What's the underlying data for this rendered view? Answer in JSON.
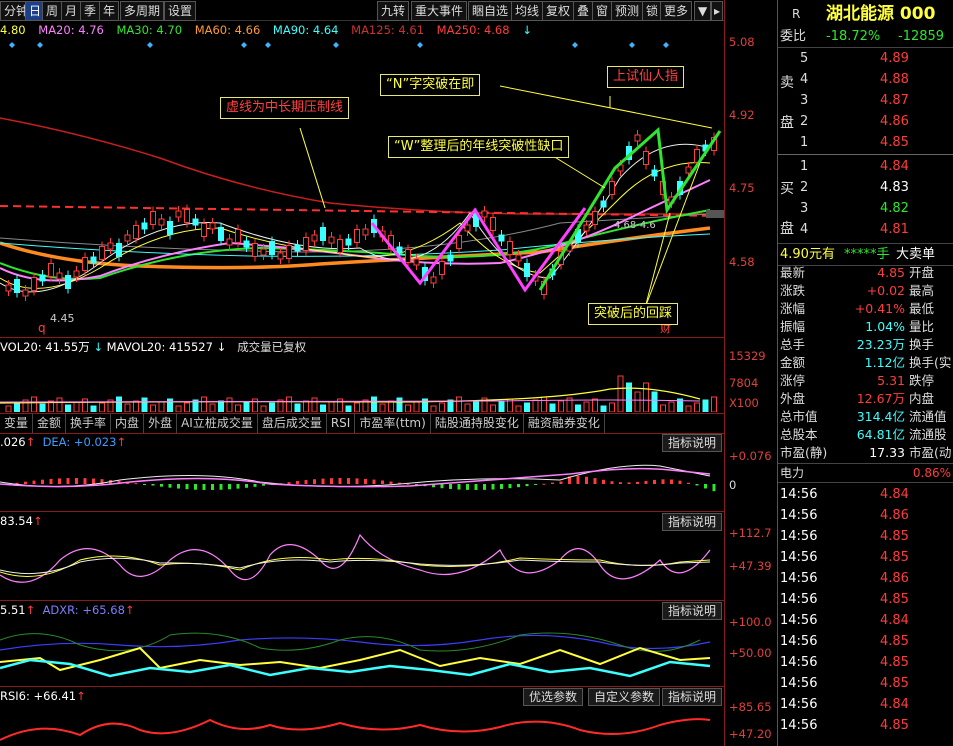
{
  "toolbar": {
    "items": [
      "分钟",
      "日",
      "周",
      "月",
      "季",
      "年",
      "多周期",
      "设置"
    ],
    "right_items": [
      "九转",
      "重大事件",
      "睏自选",
      "均线",
      "复权",
      "叠",
      "窗",
      "预测",
      "锁",
      "更多",
      "▼"
    ]
  },
  "ma_legend": [
    {
      "text": "4.80",
      "color": "#ffff3c"
    },
    {
      "text": "MA20: 4.76",
      "color": "#ff80ff"
    },
    {
      "text": "MA30: 4.70",
      "color": "#2ee62e"
    },
    {
      "text": "MA60: 4.66",
      "color": "#ff9a2e"
    },
    {
      "text": "MA90: 4.64",
      "color": "#3cffff"
    },
    {
      "text": "MA125: 4.61",
      "color": "#cc2222"
    },
    {
      "text": "MA250: 4.68",
      "color": "#ff3c3c"
    }
  ],
  "price_axis": [
    "5.08",
    "4.92",
    "4.75",
    "4.58"
  ],
  "annotations": {
    "resistance": "虚线为中长期压制线",
    "n_breakout": "“N”字突破在即",
    "immortal": "上试仙人指",
    "w_gap": "“W”整理后的年线突破性缺口",
    "pullback": "突破后的回踩"
  },
  "chart_labels": {
    "low": "4.45",
    "gap": "4.68-4.6",
    "q": "q",
    "cai": "财"
  },
  "volume": {
    "legend_a": "VOL20: 41.55万",
    "legend_b": "MAVOL20: 415527",
    "legend_c": "成交量已复权",
    "axis": [
      "15329",
      "7804",
      "X100"
    ]
  },
  "tabs": [
    "变量",
    "金额",
    "换手率",
    "内盘",
    "外盘",
    "AI立桩成交量",
    "盘后成交量",
    "RSI",
    "市盈率(ttm)",
    "陆股通持股变化",
    "融资融券变化"
  ],
  "macd": {
    "legend_a": ".026",
    "legend_b": "DEA: +0.023",
    "axis": [
      "+0.076",
      "0"
    ],
    "btn": "指标说明"
  },
  "kdj": {
    "legend_a": "83.54",
    "axis": [
      "+112.7",
      "+47.39"
    ],
    "btn": "指标说明"
  },
  "dmi": {
    "legend_a": "5.51",
    "legend_b": "ADXR: +65.68",
    "axis": [
      "+100.0",
      "+50.00"
    ],
    "btn": "指标说明"
  },
  "rsi": {
    "legend_a": "RSI6: +66.41",
    "axis": [
      "+85.65",
      "+47.20"
    ],
    "btn_a": "优选参数",
    "btn_b": "自定义参数",
    "btn_c": "指标说明"
  },
  "right_panel": {
    "r_mark": "R",
    "name": "湖北能源 000",
    "weibi_label": "委比",
    "weibi_pct": "-18.72%",
    "weibi_val": "-12859",
    "sell_label_top": "卖",
    "sell_label_bot": "盘",
    "buy_label_top": "买",
    "buy_label_bot": "盘",
    "sell": [
      {
        "n": "5",
        "p": "4.89"
      },
      {
        "n": "4",
        "p": "4.88"
      },
      {
        "n": "3",
        "p": "4.87"
      },
      {
        "n": "2",
        "p": "4.86"
      },
      {
        "n": "1",
        "p": "4.85"
      }
    ],
    "buy": [
      {
        "n": "1",
        "p": "4.84"
      },
      {
        "n": "2",
        "p": "4.83"
      },
      {
        "n": "3",
        "p": "4.82"
      },
      {
        "n": "4",
        "p": "4.81"
      }
    ],
    "big_price": "4.90元有",
    "big_stars": "*****手",
    "big_label": "大卖单",
    "stats": [
      {
        "l": "最新",
        "v": "4.85",
        "r": "开盘"
      },
      {
        "l": "涨跌",
        "v": "+0.02",
        "r": "最高"
      },
      {
        "l": "涨幅",
        "v": "+0.41%",
        "r": "最低"
      },
      {
        "l": "振幅",
        "v": "1.04%",
        "r": "量比"
      },
      {
        "l": "总手",
        "v": "23.23万",
        "r": "换手"
      },
      {
        "l": "金额",
        "v": "1.12亿",
        "r": "换手(实"
      },
      {
        "l": "涨停",
        "v": "5.31",
        "r": "跌停"
      },
      {
        "l": "外盘",
        "v": "12.67万",
        "r": "内盘"
      },
      {
        "l": "总市值",
        "v": "314.4亿",
        "r": "流通值"
      },
      {
        "l": "总股本",
        "v": "64.81亿",
        "r": "流通股"
      },
      {
        "l": "市盈(静)",
        "v": "17.33",
        "r": "市盈(动"
      }
    ],
    "sector": "电力",
    "sector_pct": "0.86%",
    "ticks": [
      {
        "t": "14:56",
        "p": "4.84"
      },
      {
        "t": "14:56",
        "p": "4.86"
      },
      {
        "t": "14:56",
        "p": "4.85"
      },
      {
        "t": "14:56",
        "p": "4.85"
      },
      {
        "t": "14:56",
        "p": "4.86"
      },
      {
        "t": "14:56",
        "p": "4.85"
      },
      {
        "t": "14:56",
        "p": "4.84"
      },
      {
        "t": "14:56",
        "p": "4.85"
      },
      {
        "t": "14:56",
        "p": "4.85"
      },
      {
        "t": "14:56",
        "p": "4.85"
      },
      {
        "t": "14:56",
        "p": "4.84"
      },
      {
        "t": "14:56",
        "p": "4.85"
      }
    ]
  }
}
